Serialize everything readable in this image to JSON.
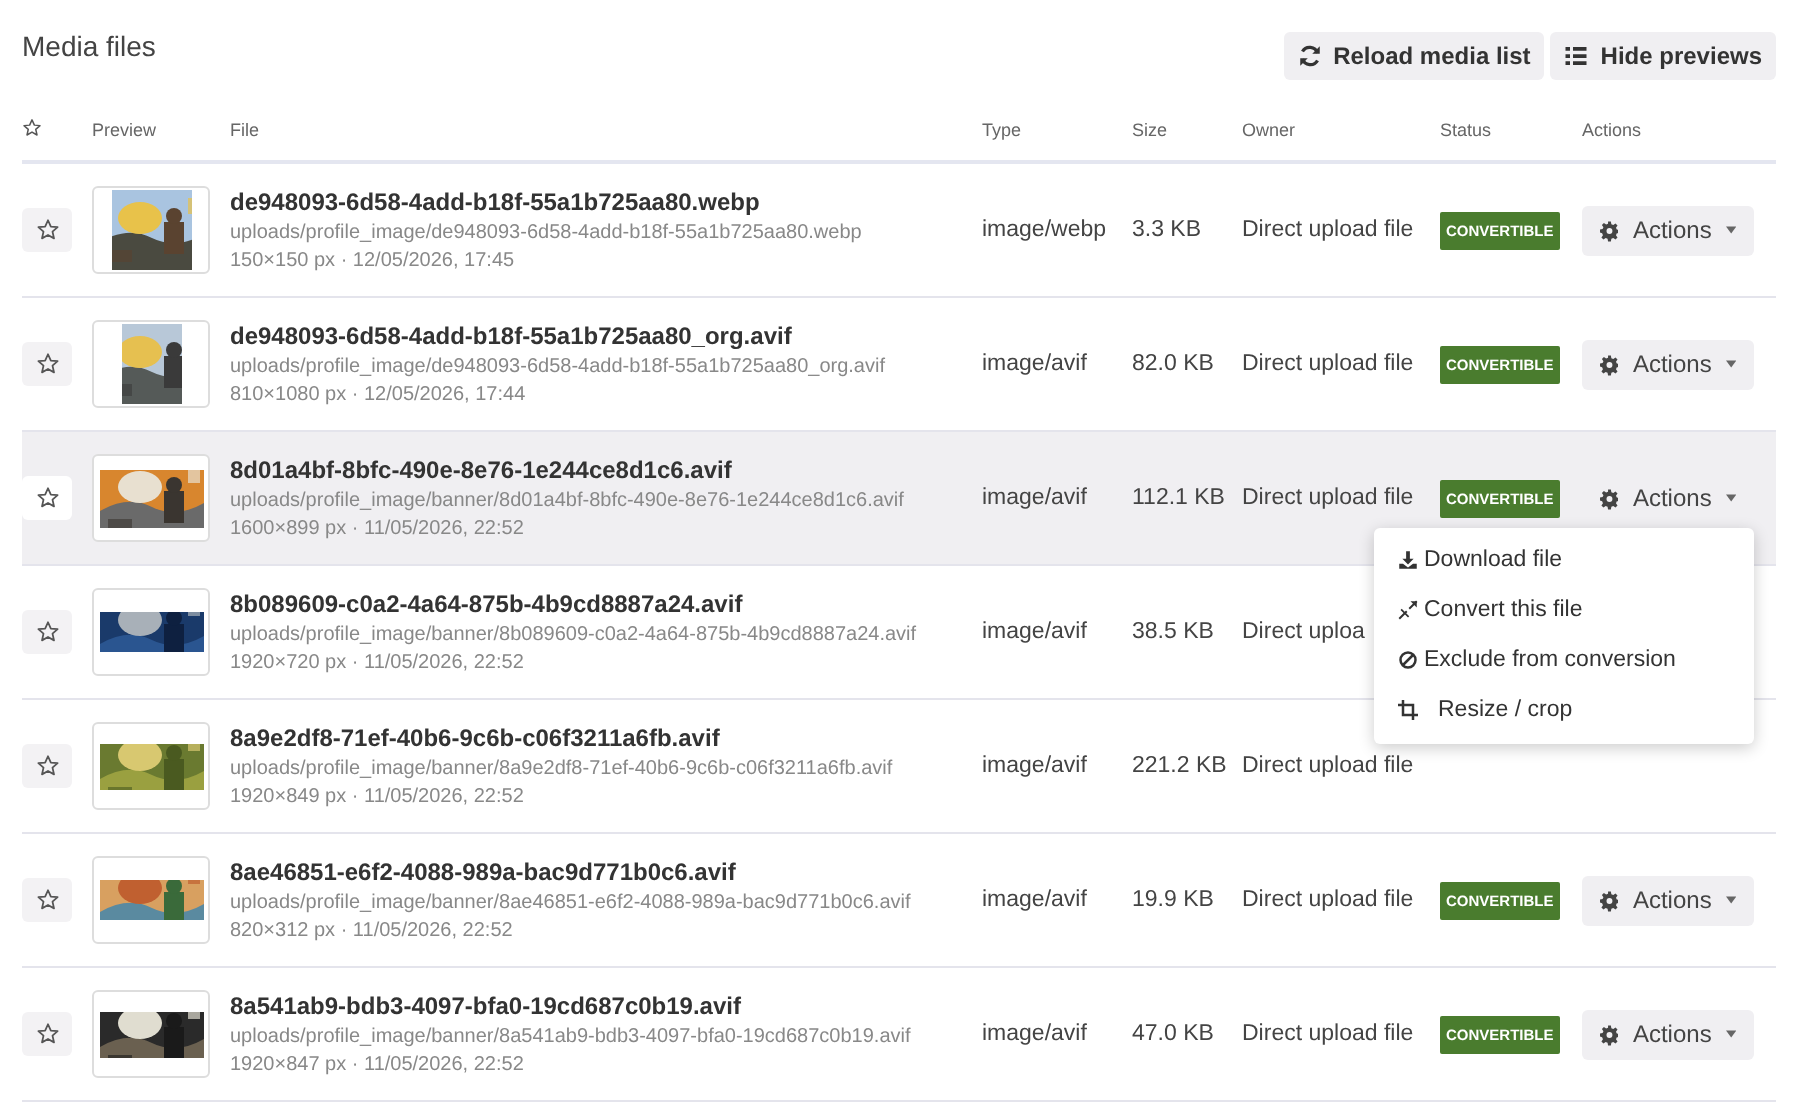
{
  "title": "Media files",
  "toolbar": [
    {
      "kind": "reload",
      "label": "Reload media list"
    },
    {
      "kind": "list",
      "label": "Hide previews"
    }
  ],
  "columns": [
    "Preview",
    "File",
    "Type",
    "Size",
    "Owner",
    "Status",
    "Actions"
  ],
  "rows": [
    {
      "starred": false,
      "highlighted": false,
      "name": "de948093-6d58-4add-b18f-55a1b725aa80.webp",
      "path": "uploads/profile_image/de948093-6d58-4add-b18f-55a1b725aa80.webp",
      "meta": "150×150 px · 12/05/2026, 17:45",
      "type": "image/webp",
      "size": "3.3 KB",
      "owner": "Direct upload file",
      "status": "CONVERTIBLE",
      "actions": "Actions"
    },
    {
      "starred": false,
      "highlighted": false,
      "name": "de948093-6d58-4add-b18f-55a1b725aa80_org.avif",
      "path": "uploads/profile_image/de948093-6d58-4add-b18f-55a1b725aa80_org.avif",
      "meta": "810×1080 px · 12/05/2026, 17:44",
      "type": "image/avif",
      "size": "82.0 KB",
      "owner": "Direct upload file",
      "status": "CONVERTIBLE",
      "actions": "Actions"
    },
    {
      "starred": false,
      "highlighted": true,
      "name": "8d01a4bf-8bfc-490e-8e76-1e244ce8d1c6.avif",
      "path": "uploads/profile_image/banner/8d01a4bf-8bfc-490e-8e76-1e244ce8d1c6.avif",
      "meta": "1600×899 px · 11/05/2026, 22:52",
      "type": "image/avif",
      "size": "112.1 KB",
      "owner": "Direct upload file",
      "status": "CONVERTIBLE",
      "actions": "Actions",
      "menu": [
        {
          "kind": "download",
          "label": "Download file"
        },
        {
          "kind": "convert",
          "label": "Convert this file"
        },
        {
          "kind": "exclude",
          "label": "Exclude from conversion"
        },
        {
          "kind": "crop",
          "label": "Resize / crop"
        }
      ]
    },
    {
      "starred": false,
      "highlighted": false,
      "name": "8b089609-c0a2-4a64-875b-4b9cd8887a24.avif",
      "path": "uploads/profile_image/banner/8b089609-c0a2-4a64-875b-4b9cd8887a24.avif",
      "meta": "1920×720 px · 11/05/2026, 22:52",
      "type": "image/avif",
      "size": "38.5 KB",
      "owner": "Direct uploa"
    },
    {
      "starred": false,
      "highlighted": false,
      "name": "8a9e2df8-71ef-40b6-9c6b-c06f3211a6fb.avif",
      "path": "uploads/profile_image/banner/8a9e2df8-71ef-40b6-9c6b-c06f3211a6fb.avif",
      "meta": "1920×849 px · 11/05/2026, 22:52",
      "type": "image/avif",
      "size": "221.2 KB",
      "owner": "Direct upload file"
    },
    {
      "starred": false,
      "highlighted": false,
      "name": "8ae46851-e6f2-4088-989a-bac9d771b0c6.avif",
      "path": "uploads/profile_image/banner/8ae46851-e6f2-4088-989a-bac9d771b0c6.avif",
      "meta": "820×312 px · 11/05/2026, 22:52",
      "type": "image/avif",
      "size": "19.9 KB",
      "owner": "Direct upload file",
      "status": "CONVERTIBLE",
      "actions": "Actions"
    },
    {
      "starred": false,
      "highlighted": false,
      "name": "8a541ab9-bdb3-4097-bfa0-19cd687c0b19.avif",
      "path": "uploads/profile_image/banner/8a541ab9-bdb3-4097-bfa0-19cd687c0b19.avif",
      "meta": "1920×847 px · 11/05/2026, 22:52",
      "type": "image/avif",
      "size": "47.0 KB",
      "owner": "Direct upload file",
      "status": "CONVERTIBLE",
      "actions": "Actions"
    }
  ]
}
